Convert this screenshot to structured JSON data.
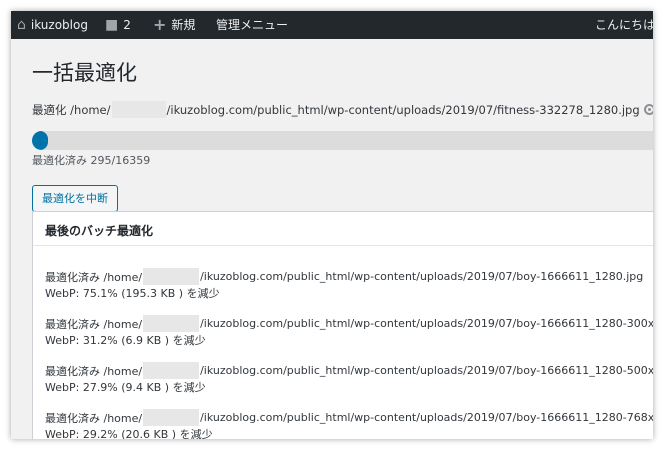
{
  "adminbar": {
    "site_name": "ikuzoblog",
    "comments_count": "2",
    "new_label": "新規",
    "menu_label": "管理メニュー",
    "greeting": "こんにちは"
  },
  "page": {
    "title": "一括最適化",
    "current_prefix": "最適化 /home/",
    "current_suffix": "/ikuzoblog.com/public_html/wp-content/uploads/2019/07/fitness-332278_1280.jpg",
    "progress_fraction": 0.018,
    "progress_text": "最適化済み 295/16359",
    "stop_button_label": "最適化を中断"
  },
  "batch": {
    "title": "最後のバッチ最適化",
    "entries": [
      {
        "prefix": "最適化済み /home/",
        "path": "/ikuzoblog.com/public_html/wp-content/uploads/2019/07/boy-1666611_1280.jpg",
        "webp": "WebP: 75.1% (195.3 KB ) を減少"
      },
      {
        "prefix": "最適化済み /home/",
        "path": "/ikuzoblog.com/public_html/wp-content/uploads/2019/07/boy-1666611_1280-300x",
        "webp": "WebP: 31.2% (6.9 KB ) を減少"
      },
      {
        "prefix": "最適化済み /home/",
        "path": "/ikuzoblog.com/public_html/wp-content/uploads/2019/07/boy-1666611_1280-500x",
        "webp": "WebP: 27.9% (9.4 KB ) を減少"
      },
      {
        "prefix": "最適化済み /home/",
        "path": "/ikuzoblog.com/public_html/wp-content/uploads/2019/07/boy-1666611_1280-768x",
        "webp": "WebP: 29.2% (20.6 KB ) を減少"
      }
    ]
  },
  "colors": {
    "adminbar_bg": "#23282d",
    "progress_fill": "#0073aa",
    "progress_track": "#dcdcdc",
    "button_border": "#0071a1"
  },
  "icons": [
    "home-icon",
    "comment-icon",
    "plus-icon",
    "spinner-icon"
  ]
}
